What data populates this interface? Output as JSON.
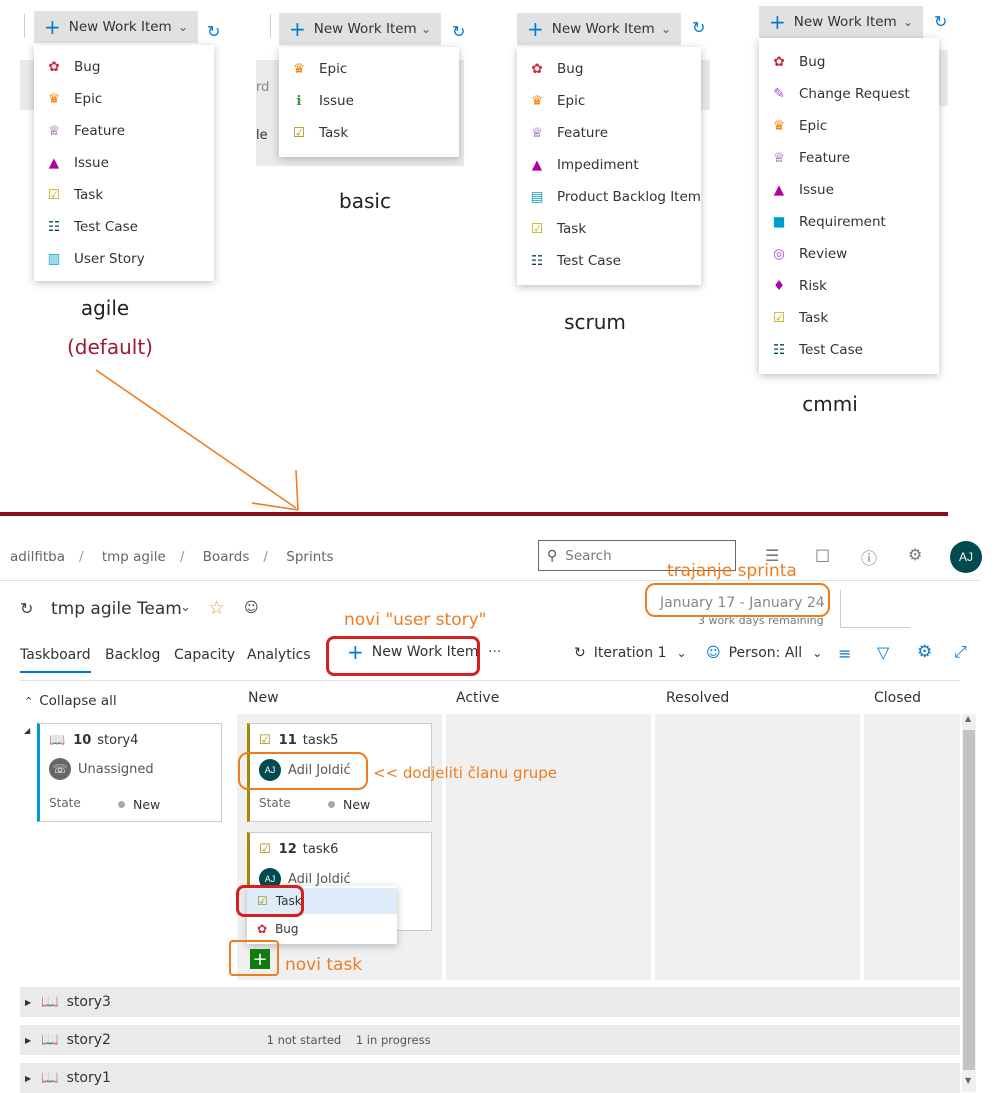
{
  "templates": {
    "new_work_item_label": "New Work Item",
    "agile": {
      "caption": "agile",
      "subcaption": "(default)",
      "items": [
        {
          "label": "Bug",
          "icon": "bug-icon"
        },
        {
          "label": "Epic",
          "icon": "crown-icon"
        },
        {
          "label": "Feature",
          "icon": "trophy-icon"
        },
        {
          "label": "Issue",
          "icon": "issue-flask-icon"
        },
        {
          "label": "Task",
          "icon": "task-clipboard-icon"
        },
        {
          "label": "Test Case",
          "icon": "test-case-icon"
        },
        {
          "label": "User Story",
          "icon": "book-icon"
        }
      ]
    },
    "basic": {
      "caption": "basic",
      "items": [
        {
          "label": "Epic",
          "icon": "crown-icon"
        },
        {
          "label": "Issue",
          "icon": "issue-info-icon"
        },
        {
          "label": "Task",
          "icon": "task-check-icon"
        }
      ]
    },
    "scrum": {
      "caption": "scrum",
      "items": [
        {
          "label": "Bug",
          "icon": "bug-icon"
        },
        {
          "label": "Epic",
          "icon": "crown-icon"
        },
        {
          "label": "Feature",
          "icon": "trophy-icon"
        },
        {
          "label": "Impediment",
          "icon": "issue-flask-icon"
        },
        {
          "label": "Product Backlog Item",
          "icon": "backlog-item-icon"
        },
        {
          "label": "Task",
          "icon": "task-clipboard-icon"
        },
        {
          "label": "Test Case",
          "icon": "test-case-icon"
        }
      ]
    },
    "cmmi": {
      "caption": "cmmi",
      "items": [
        {
          "label": "Bug",
          "icon": "bug-icon"
        },
        {
          "label": "Change Request",
          "icon": "change-request-icon"
        },
        {
          "label": "Epic",
          "icon": "crown-icon"
        },
        {
          "label": "Feature",
          "icon": "trophy-icon"
        },
        {
          "label": "Issue",
          "icon": "issue-flask-icon"
        },
        {
          "label": "Requirement",
          "icon": "requirement-icon"
        },
        {
          "label": "Review",
          "icon": "review-icon"
        },
        {
          "label": "Risk",
          "icon": "risk-icon"
        },
        {
          "label": "Task",
          "icon": "task-clipboard-icon"
        },
        {
          "label": "Test Case",
          "icon": "test-case-icon"
        }
      ]
    },
    "partial_labels": {
      "basic_left_1": "rd",
      "basic_left_2": "le"
    }
  },
  "header": {
    "breadcrumbs": [
      "adilfitba",
      "tmp agile",
      "Boards",
      "Sprints"
    ],
    "search_placeholder": "Search",
    "user_initials": "AJ"
  },
  "team": {
    "name": "tmp agile Team",
    "date_range": "January 17 - January 24",
    "remaining": "3 work days remaining"
  },
  "tabs": [
    "Taskboard",
    "Backlog",
    "Capacity",
    "Analytics"
  ],
  "toolbar": {
    "new_work_item": "New Work Item",
    "more": "···",
    "iteration": "Iteration 1",
    "person": "Person: All"
  },
  "board": {
    "collapse_all": "Collapse all",
    "columns": [
      "New",
      "Active",
      "Resolved",
      "Closed"
    ],
    "story_card": {
      "id": "10",
      "title": "story4",
      "assignee": "Unassigned",
      "state_label": "State",
      "state": "New"
    },
    "task_cards": [
      {
        "id": "11",
        "title": "task5",
        "assignee": "Adil Joldić",
        "initials": "AJ",
        "state_label": "State",
        "state": "New"
      },
      {
        "id": "12",
        "title": "task6",
        "assignee": "Adil Joldić",
        "initials": "AJ"
      }
    ],
    "add_menu": [
      "Task",
      "Bug"
    ],
    "rows": [
      {
        "title": "story3",
        "summary": ""
      },
      {
        "title": "story2",
        "summary": "1 not started    1 in progress"
      },
      {
        "title": "story1",
        "summary": ""
      }
    ]
  },
  "annotations": {
    "sprint_duration": "trajanje sprinta",
    "new_user_story": "novi \"user story\"",
    "assign_member": "<< dodjeliti članu grupe",
    "new_task": "novi task"
  },
  "colors": {
    "accent": "#0078d4",
    "separator": "#8b0f1f",
    "annotation": "#ee7d22",
    "highlight": "#d62020",
    "task": "#a4880a",
    "story": "#009ccc",
    "bug": "#cc293d",
    "epic": "#ff7b00",
    "feature": "#773b93",
    "issue": "#b4009e"
  }
}
